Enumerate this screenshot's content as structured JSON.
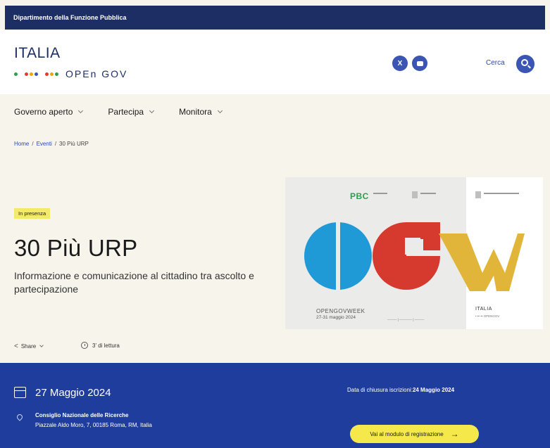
{
  "topbar": {
    "label": "Dipartimento della Funzione Pubblica"
  },
  "header": {
    "logo_line1": "ITALIA",
    "logo_line2": "OPEn GOV",
    "logo_dot_colors": [
      "#2e9e4e",
      "#e03c31",
      "#f0a500",
      "#3a55b4",
      "#e03c31",
      "#f0a500",
      "#2e9e4e"
    ],
    "social": [
      {
        "name": "x",
        "label": "X",
        "icon": "x-icon"
      },
      {
        "name": "youtube",
        "label": "",
        "icon": "youtube-icon"
      }
    ],
    "search_label": "Cerca",
    "search_icon": "search-icon"
  },
  "nav": {
    "items": [
      {
        "label": "Governo aperto"
      },
      {
        "label": "Partecipa"
      },
      {
        "label": "Monitora"
      }
    ]
  },
  "breadcrumb": {
    "home": "Home",
    "events": "Eventi",
    "current": "30 Più URP",
    "separator": "/"
  },
  "event": {
    "badge": "In presenza",
    "title": "30 Più URP",
    "subtitle": "Informazione e comunicazione al cittadino tra ascolto e partecipazione",
    "share_label": "Share",
    "reading_time": "3' di lettura"
  },
  "hero_image": {
    "pbc_logo": "PBC",
    "letters": [
      "O",
      "G",
      "W"
    ],
    "letter_colors": [
      "#1f9ad6",
      "#d63a2f",
      "#e0b53a"
    ],
    "opengovweek": "OPENGOVWEEK",
    "dates": "27-31 maggio 2024",
    "italia": "ITALIA"
  },
  "info_band": {
    "date": "27 Maggio 2024",
    "venue": "Consiglio Nazionale delle Ricerche",
    "address": "Piazzale Aldo Moro, 7, 00185 Roma, RM, Italia",
    "deadline_label": "Data di chiusura iscrizioni:",
    "deadline_date": "24 Maggio 2024",
    "cta_label": "Vai al modulo di registrazione",
    "cta_arrow": "→"
  }
}
